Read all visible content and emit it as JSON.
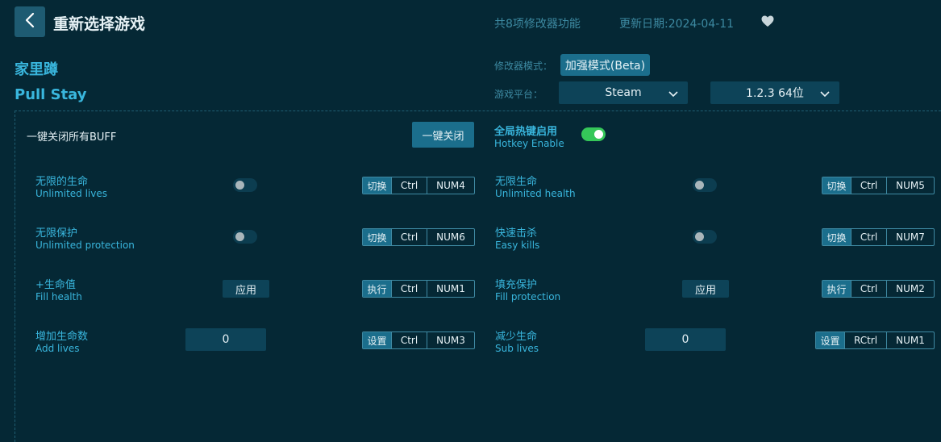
{
  "header": {
    "title": "重新选择游戏",
    "feature_count": "共8项修改器功能",
    "update_date": "更新日期:2024-04-11"
  },
  "game": {
    "name_cn": "家里蹲",
    "name_en": "Pull Stay"
  },
  "settings": {
    "mode_label": "修改器模式：",
    "mode_value": "加强模式(Beta)",
    "platform_label": "游戏平台：",
    "platform_value": "Steam",
    "version_value": "1.2.3 64位"
  },
  "controls": {
    "all_off_label": "一键关闭所有BUFF",
    "all_off_button": "一键关闭",
    "hotkey_cn": "全局热键启用",
    "hotkey_en": "Hotkey Enable",
    "hotkey_enabled": true
  },
  "options": [
    {
      "cn": "无限的生命",
      "en": "Unlimited lives",
      "control": "toggle",
      "action": "切换",
      "mod": "Ctrl",
      "key": "NUM4"
    },
    {
      "cn": "无限生命",
      "en": "Unlimited health",
      "control": "toggle",
      "action": "切换",
      "mod": "Ctrl",
      "key": "NUM5"
    },
    {
      "cn": "无限保护",
      "en": "Unlimited protection",
      "control": "toggle",
      "action": "切换",
      "mod": "Ctrl",
      "key": "NUM6"
    },
    {
      "cn": "快速击杀",
      "en": "Easy kills",
      "control": "toggle",
      "action": "切换",
      "mod": "Ctrl",
      "key": "NUM7"
    },
    {
      "cn": "+生命值",
      "en": "Fill health",
      "control": "apply",
      "apply_label": "应用",
      "action": "执行",
      "mod": "Ctrl",
      "key": "NUM1"
    },
    {
      "cn": "填充保护",
      "en": "Fill protection",
      "control": "apply",
      "apply_label": "应用",
      "action": "执行",
      "mod": "Ctrl",
      "key": "NUM2"
    },
    {
      "cn": "增加生命数",
      "en": "Add lives",
      "control": "input",
      "value": "0",
      "action": "设置",
      "mod": "Ctrl",
      "key": "NUM3"
    },
    {
      "cn": "减少生命",
      "en": "Sub lives",
      "control": "input",
      "value": "0",
      "action": "设置",
      "mod": "RCtrl",
      "key": "NUM1"
    }
  ],
  "colors": {
    "background": "#052835",
    "accent": "#39b6dd",
    "button": "#1b6e8c",
    "toggle_on": "#35c759"
  },
  "icons": {
    "back": "chevron-left-icon",
    "favorite": "heart-icon",
    "dropdown": "chevron-down-icon"
  }
}
